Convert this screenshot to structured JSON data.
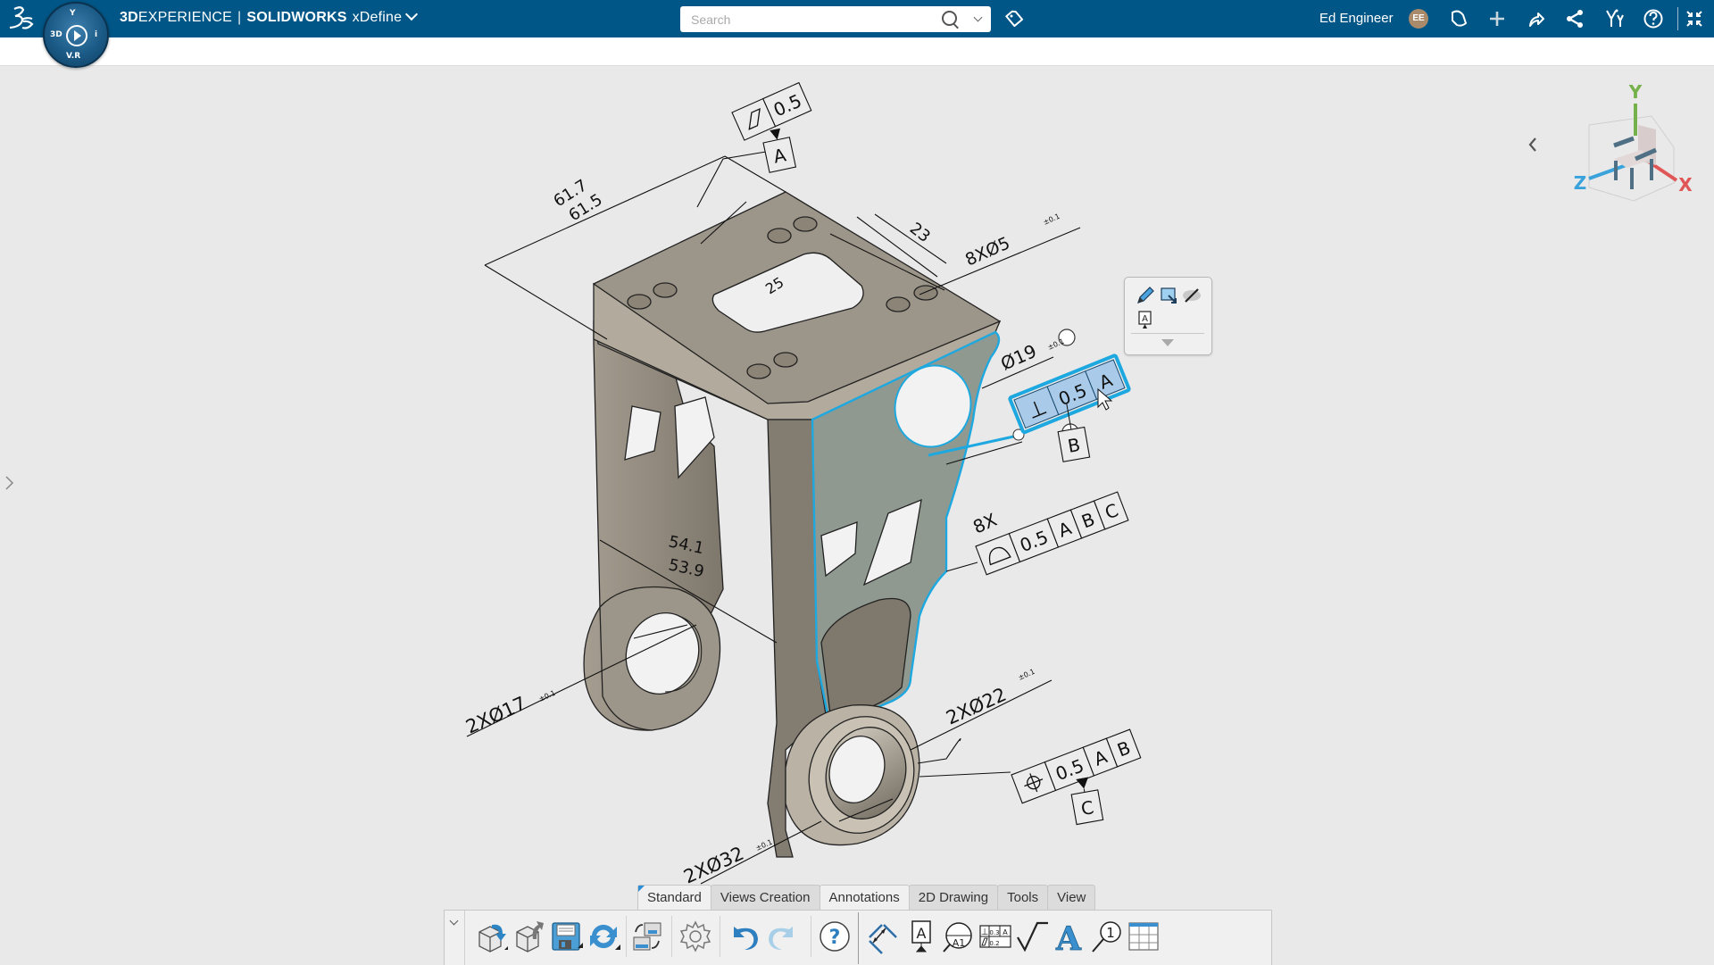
{
  "header": {
    "brand_bold": "3D",
    "brand_rest": "EXPERIENCE",
    "brand_sep": "|",
    "product": "SOLIDWORKS",
    "app": "xDefine",
    "search_placeholder": "Search",
    "search_value": "",
    "user_name": "Ed Engineer",
    "user_initials": "EE",
    "compass": {
      "top": "Y",
      "left": "3D",
      "right": "i",
      "bottom": "V.R"
    },
    "icons": [
      "3ds-logo-icon",
      "compass-icon",
      "search-icon",
      "chevron-down-icon",
      "tag-icon",
      "notifications-icon",
      "add-icon",
      "share-icon",
      "social-share-icon",
      "compass-apps-icon",
      "help-icon",
      "fullscreen-icon"
    ]
  },
  "colors": {
    "header_bg": "#005686",
    "viewport_bg": "#e9e9e9",
    "part_top": "#9c9589",
    "part_side": "#867f72",
    "selection": "#1ea8e0",
    "selected_face": "#8f9990",
    "axis_x": "#e05555",
    "axis_y": "#74b14a",
    "axis_z": "#3ba3dc"
  },
  "annotations": {
    "flatness_fcf": {
      "symbol": "flatness",
      "tolerance": "0.5",
      "datum": "A"
    },
    "dim_length": {
      "upper": "61.7",
      "lower": "61.5"
    },
    "dim_23": "23",
    "dim_25": "25",
    "holes_8x": {
      "text": "8XØ5",
      "tol": "±0.1"
    },
    "dia_19": {
      "text": "Ø19",
      "tol": "±0.1"
    },
    "selected_fcf": {
      "symbol": "perpendicularity",
      "symbol_glyph": "⊥",
      "tolerance": "0.5",
      "datum_ref": "A",
      "datum_feature": "B"
    },
    "profile_fcf": {
      "count": "8X",
      "symbol": "profile-of-surface",
      "tolerance": "0.5",
      "datums": [
        "A",
        "B",
        "C"
      ]
    },
    "dim_54": {
      "upper": "54.1",
      "lower": "53.9"
    },
    "holes_17": {
      "text": "2XØ17",
      "tol": "±0.1"
    },
    "holes_22": {
      "text": "2XØ22",
      "tol": "±0.1"
    },
    "holes_32": {
      "text": "2XØ32",
      "tol": "±0.1"
    },
    "position_fcf": {
      "symbol": "position",
      "tolerance": "0.5",
      "datums": [
        "A",
        "B"
      ],
      "datum_feature": "C"
    }
  },
  "view_cube": {
    "x_label": "X",
    "y_label": "Y",
    "z_label": "Z"
  },
  "mini_toolbar": {
    "items": [
      {
        "name": "edit-icon"
      },
      {
        "name": "capture-icon"
      },
      {
        "name": "hide-icon"
      },
      {
        "name": "note-icon"
      }
    ],
    "more": "more-options-icon"
  },
  "tabs": [
    {
      "label": "Standard",
      "active": false
    },
    {
      "label": "Views Creation",
      "active": false
    },
    {
      "label": "Annotations",
      "active": true
    },
    {
      "label": "2D Drawing",
      "active": false
    },
    {
      "label": "Tools",
      "active": false
    },
    {
      "label": "View",
      "active": false
    }
  ],
  "toolbar": {
    "tools": [
      {
        "name": "open-icon"
      },
      {
        "name": "revert-icon"
      },
      {
        "name": "save-icon"
      },
      {
        "name": "refresh-icon"
      },
      {
        "name": "manage-sessions-icon"
      },
      {
        "name": "options-icon"
      },
      {
        "name": "undo-icon"
      },
      {
        "name": "redo-icon"
      },
      {
        "name": "help-icon"
      },
      {
        "name": "smart-dimension-icon"
      },
      {
        "name": "datum-feature-icon"
      },
      {
        "name": "datum-target-icon"
      },
      {
        "name": "geometric-tolerance-icon"
      },
      {
        "name": "surface-finish-icon"
      },
      {
        "name": "text-icon"
      },
      {
        "name": "balloon-icon"
      },
      {
        "name": "table-icon"
      }
    ]
  }
}
